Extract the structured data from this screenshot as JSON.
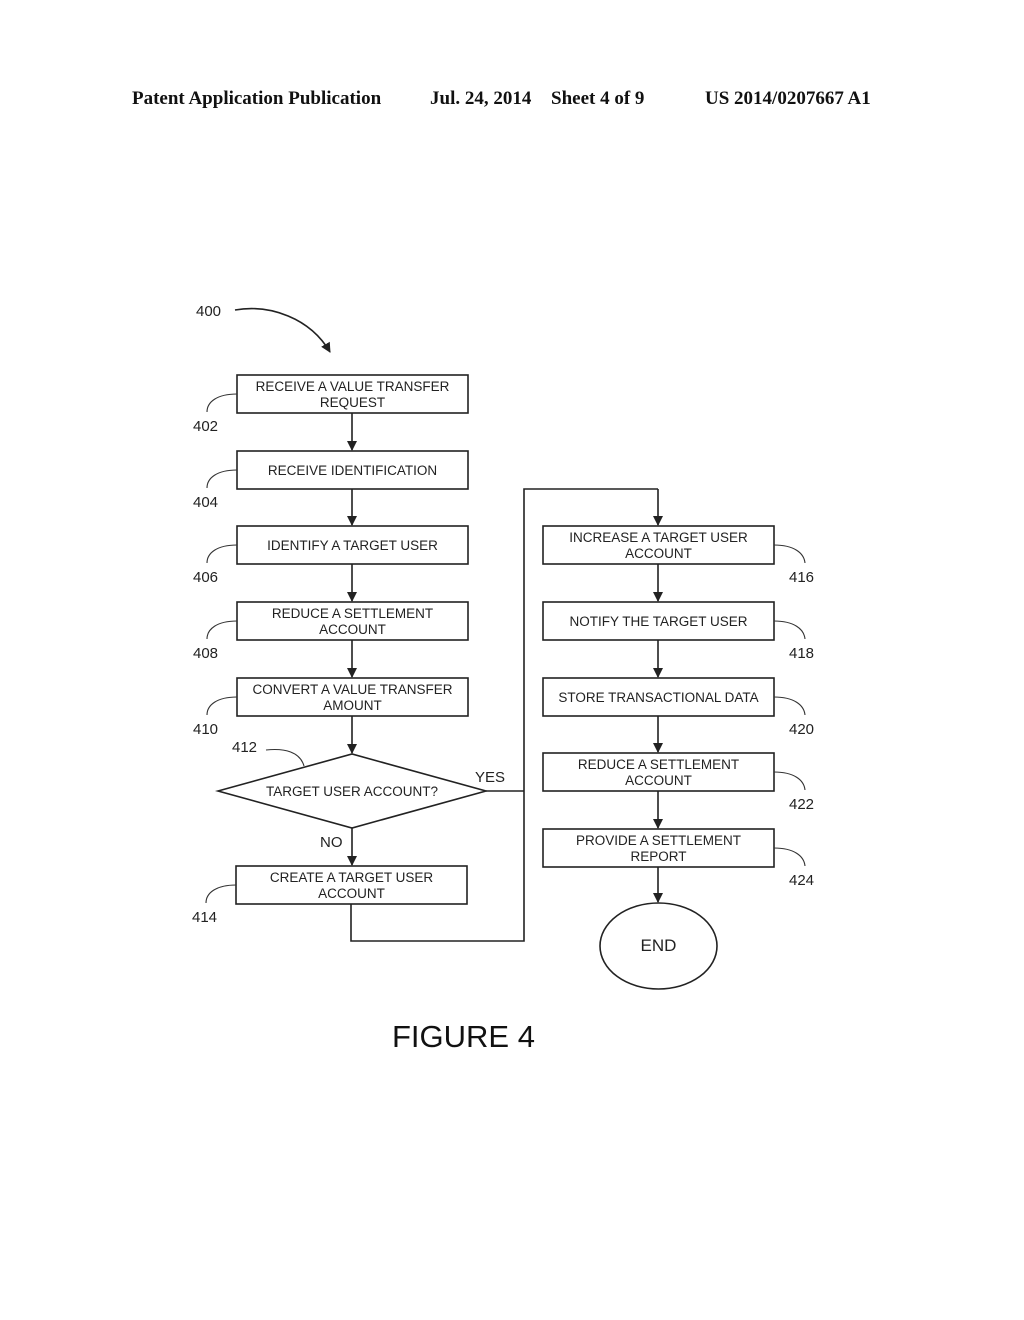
{
  "header": {
    "publication": "Patent Application Publication",
    "date": "Jul. 24, 2014",
    "sheet": "Sheet 4 of 9",
    "number": "US 2014/0207667 A1"
  },
  "figure": {
    "ref": "400",
    "caption": "FIGURE 4",
    "steps": [
      {
        "id": "402",
        "lines": [
          "RECEIVE A VALUE TRANSFER",
          "REQUEST"
        ]
      },
      {
        "id": "404",
        "lines": [
          "RECEIVE IDENTIFICATION"
        ]
      },
      {
        "id": "406",
        "lines": [
          "IDENTIFY A TARGET USER"
        ]
      },
      {
        "id": "408",
        "lines": [
          "REDUCE A SETTLEMENT",
          "ACCOUNT"
        ]
      },
      {
        "id": "410",
        "lines": [
          "CONVERT A VALUE TRANSFER",
          "AMOUNT"
        ]
      },
      {
        "id": "412",
        "lines": [
          "TARGET USER ACCOUNT?"
        ],
        "type": "decision"
      },
      {
        "id": "414",
        "lines": [
          "CREATE A TARGET USER",
          "ACCOUNT"
        ]
      },
      {
        "id": "416",
        "lines": [
          "INCREASE A TARGET USER",
          "ACCOUNT"
        ]
      },
      {
        "id": "418",
        "lines": [
          "NOTIFY THE TARGET USER"
        ]
      },
      {
        "id": "420",
        "lines": [
          "STORE TRANSACTIONAL DATA"
        ]
      },
      {
        "id": "422",
        "lines": [
          "REDUCE A SETTLEMENT",
          "ACCOUNT"
        ]
      },
      {
        "id": "424",
        "lines": [
          "PROVIDE A SETTLEMENT",
          "REPORT"
        ]
      },
      {
        "id": "end",
        "lines": [
          "END"
        ],
        "type": "terminal"
      }
    ],
    "branches": {
      "yes": "YES",
      "no": "NO"
    }
  }
}
